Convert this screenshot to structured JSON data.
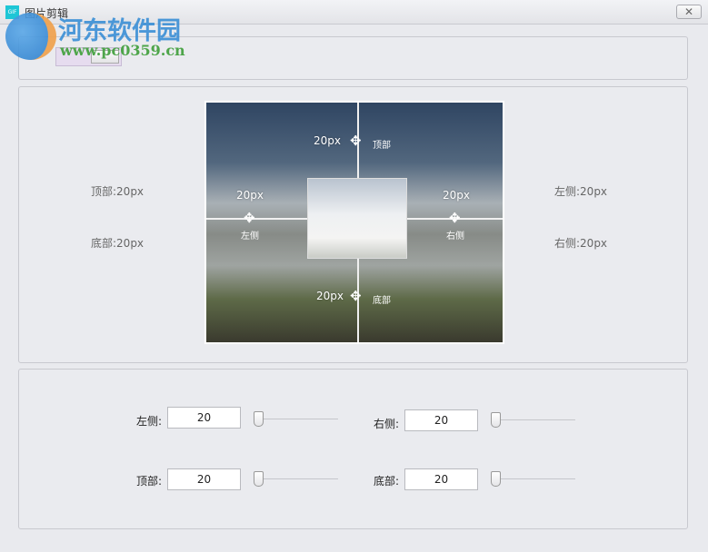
{
  "window": {
    "title": "图片剪辑",
    "app_icon": "GIF",
    "close_icon": "close-icon"
  },
  "watermark": {
    "name": "河东软件园",
    "url": "www.pc0359.cn"
  },
  "preview": {
    "outside_labels": {
      "top": "顶部:20px",
      "bottom": "底部:20px",
      "left": "左侧:20px",
      "right": "右侧:20px"
    },
    "handles": {
      "top": {
        "value": "20px",
        "label": "顶部"
      },
      "bottom": {
        "value": "20px",
        "label": "底部"
      },
      "left": {
        "value": "20px",
        "label": "左侧"
      },
      "right": {
        "value": "20px",
        "label": "右侧"
      }
    },
    "move_icon": "✥"
  },
  "controls": {
    "left": {
      "label": "左侧:",
      "value": "20"
    },
    "right": {
      "label": "右侧:",
      "value": "20"
    },
    "top": {
      "label": "顶部:",
      "value": "20"
    },
    "bottom": {
      "label": "底部:",
      "value": "20"
    }
  }
}
